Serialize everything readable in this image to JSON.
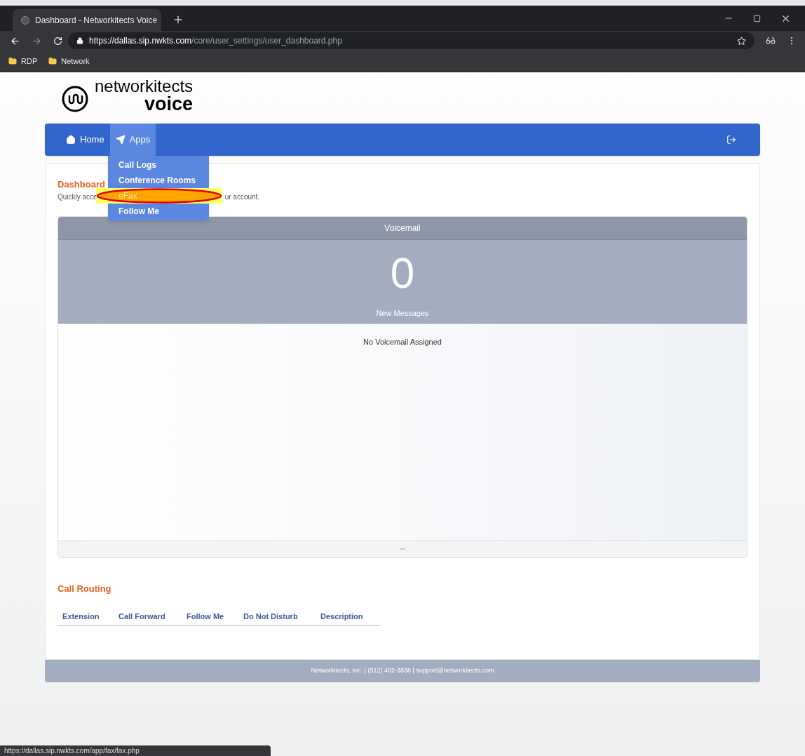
{
  "browser": {
    "tab_title": "Dashboard - Networkitects Voice",
    "url_host": "https://dallas.sip.nwkts.com",
    "url_path": "/core/user_settings/user_dashboard.php",
    "bookmarks": [
      "RDP",
      "Network"
    ]
  },
  "logo": {
    "line1": "networkitects",
    "line2": "voice"
  },
  "nav": {
    "items": [
      {
        "label": "Home",
        "selected": false
      },
      {
        "label": "Apps",
        "selected": true
      }
    ]
  },
  "apps_menu": [
    {
      "label": "Call Logs",
      "highlighted": false
    },
    {
      "label": "Conference Rooms",
      "highlighted": false
    },
    {
      "label": "eFax",
      "highlighted": true
    },
    {
      "label": "Follow Me",
      "highlighted": false
    }
  ],
  "dashboard": {
    "title": "Dashboard",
    "description_start": "Quickly acce",
    "description_end": "ur account."
  },
  "voicemail": {
    "title": "Voicemail",
    "count": "0",
    "count_label": "New Messages",
    "message": "No Voicemail Assigned",
    "more": "•••"
  },
  "call_routing": {
    "title": "Call Routing",
    "columns": [
      "Extension",
      "Call Forward",
      "Follow Me",
      "Do Not Disturb",
      "Description"
    ]
  },
  "footer": "Networkitects, Inc. | (512) 402-3838 | support@networkitects.com",
  "status_url": "https://dallas.sip.nwkts.com/app/fax/fax.php"
}
